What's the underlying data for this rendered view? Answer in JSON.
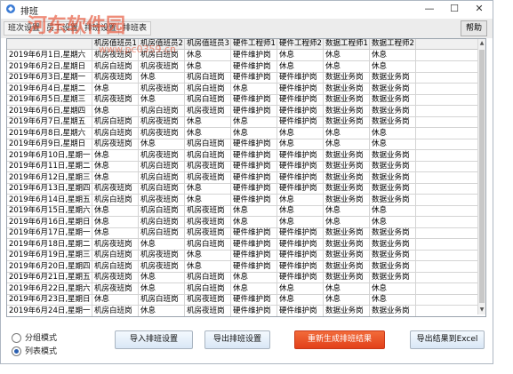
{
  "window": {
    "title": "排班",
    "controls": {
      "minimize": "—",
      "maximize": "☐",
      "close": "✕"
    }
  },
  "toolbar": {
    "tabs": [
      "班次设置",
      "员工设置",
      "排班设置",
      "排班表"
    ],
    "help_label": "帮助"
  },
  "watermark": {
    "main": "河东软件园",
    "sub": "www.pc0359.cn"
  },
  "table": {
    "columns": [
      "",
      "机房值班员1",
      "机房值班员2",
      "机房值班员3",
      "硬件工程师1",
      "硬件工程师2",
      "数据工程师1",
      "数据工程师2"
    ],
    "rows": [
      [
        "2019年6月1日,星期六",
        "机房夜班岗",
        "机房白班岗",
        "休息",
        "硬件维护岗",
        "休息",
        "休息",
        "休息"
      ],
      [
        "2019年6月2日,星期日",
        "机房白班岗",
        "机房夜班岗",
        "休息",
        "硬件维护岗",
        "休息",
        "休息",
        "休息"
      ],
      [
        "2019年6月3日,星期一",
        "机房夜班岗",
        "休息",
        "机房白班岗",
        "硬件维护岗",
        "硬件维护岗",
        "数据业务岗",
        "数据业务岗"
      ],
      [
        "2019年6月4日,星期二",
        "休息",
        "机房夜班岗",
        "机房白班岗",
        "休息",
        "硬件维护岗",
        "数据业务岗",
        "数据业务岗"
      ],
      [
        "2019年6月5日,星期三",
        "机房夜班岗",
        "休息",
        "机房白班岗",
        "硬件维护岗",
        "硬件维护岗",
        "数据业务岗",
        "数据业务岗"
      ],
      [
        "2019年6月6日,星期四",
        "休息",
        "机房白班岗",
        "机房夜班岗",
        "硬件维护岗",
        "硬件维护岗",
        "数据业务岗",
        "数据业务岗"
      ],
      [
        "2019年6月7日,星期五",
        "机房白班岗",
        "机房夜班岗",
        "休息",
        "休息",
        "硬件维护岗",
        "数据业务岗",
        "数据业务岗"
      ],
      [
        "2019年6月8日,星期六",
        "机房白班岗",
        "机房夜班岗",
        "休息",
        "休息",
        "休息",
        "休息",
        "休息"
      ],
      [
        "2019年6月9日,星期日",
        "机房夜班岗",
        "休息",
        "机房白班岗",
        "硬件维护岗",
        "休息",
        "休息",
        "休息"
      ],
      [
        "2019年6月10日,星期一",
        "休息",
        "机房夜班岗",
        "机房白班岗",
        "硬件维护岗",
        "硬件维护岗",
        "数据业务岗",
        "数据业务岗"
      ],
      [
        "2019年6月11日,星期二",
        "休息",
        "机房白班岗",
        "机房夜班岗",
        "硬件维护岗",
        "硬件维护岗",
        "数据业务岗",
        "数据业务岗"
      ],
      [
        "2019年6月12日,星期三",
        "休息",
        "机房白班岗",
        "机房夜班岗",
        "硬件维护岗",
        "硬件维护岗",
        "数据业务岗",
        "数据业务岗"
      ],
      [
        "2019年6月13日,星期四",
        "机房夜班岗",
        "机房白班岗",
        "休息",
        "硬件维护岗",
        "硬件维护岗",
        "数据业务岗",
        "数据业务岗"
      ],
      [
        "2019年6月14日,星期五",
        "机房白班岗",
        "机房夜班岗",
        "休息",
        "硬件维护岗",
        "休息",
        "数据业务岗",
        "数据业务岗"
      ],
      [
        "2019年6月15日,星期六",
        "休息",
        "机房白班岗",
        "机房夜班岗",
        "休息",
        "休息",
        "休息",
        "休息"
      ],
      [
        "2019年6月16日,星期日",
        "休息",
        "机房白班岗",
        "机房夜班岗",
        "休息",
        "休息",
        "休息",
        "休息"
      ],
      [
        "2019年6月17日,星期一",
        "休息",
        "机房白班岗",
        "机房夜班岗",
        "硬件维护岗",
        "硬件维护岗",
        "数据业务岗",
        "数据业务岗"
      ],
      [
        "2019年6月18日,星期二",
        "机房夜班岗",
        "休息",
        "机房白班岗",
        "硬件维护岗",
        "硬件维护岗",
        "数据业务岗",
        "数据业务岗"
      ],
      [
        "2019年6月19日,星期三",
        "机房白班岗",
        "机房夜班岗",
        "休息",
        "硬件维护岗",
        "硬件维护岗",
        "数据业务岗",
        "数据业务岗"
      ],
      [
        "2019年6月20日,星期四",
        "机房白班岗",
        "机房夜班岗",
        "休息",
        "硬件维护岗",
        "硬件维护岗",
        "数据业务岗",
        "数据业务岗"
      ],
      [
        "2019年6月21日,星期五",
        "机房夜班岗",
        "休息",
        "机房白班岗",
        "休息",
        "硬件维护岗",
        "数据业务岗",
        "数据业务岗"
      ],
      [
        "2019年6月22日,星期六",
        "机房夜班岗",
        "休息",
        "机房白班岗",
        "休息",
        "休息",
        "休息",
        "休息"
      ],
      [
        "2019年6月23日,星期日",
        "休息",
        "机房白班岗",
        "机房夜班岗",
        "硬件维护岗",
        "休息",
        "休息",
        "休息"
      ],
      [
        "2019年6月24日,星期一",
        "机房白班岗",
        "休息",
        "机房夜班岗",
        "硬件维护岗",
        "硬件维护岗",
        "数据业务岗",
        "数据业务岗"
      ]
    ]
  },
  "mode": {
    "options": [
      "分组模式",
      "列表模式"
    ],
    "selected": "列表模式"
  },
  "buttons": {
    "import": "导入排班设置",
    "export": "导出排班设置",
    "regenerate": "重新生成排班结果",
    "export_excel": "导出结果到Excel"
  },
  "colors": {
    "accent_red": "#e2401a",
    "button_blue": "#d9e7f6",
    "border": "#9aa3ad"
  }
}
